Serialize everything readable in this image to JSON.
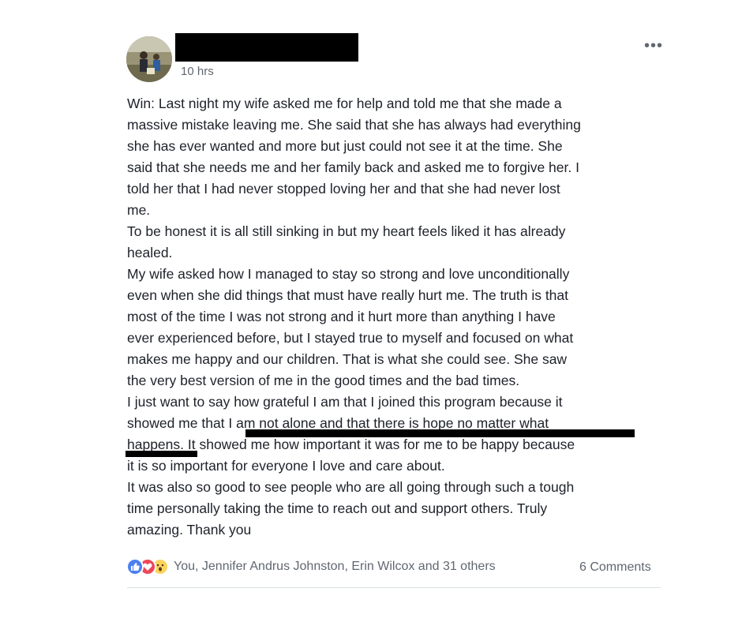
{
  "post": {
    "timestamp": "10 hrs",
    "more_label": "•••",
    "text": "Win: Last night my wife asked me for help and told me that she made a\nmassive mistake leaving me. She said that she has always had everything\nshe has ever wanted and more but just could not see it at the time. She\nsaid that she needs me and her family back and asked me to forgive her. I\ntold her that I had never stopped loving her and that she had never lost\nme.\nTo be honest it is all still sinking in but my heart feels liked it has already\nhealed.\nMy wife asked how I managed to stay so strong and love unconditionally\neven when she did things that must have really hurt me. The truth is that\nmost of the time I was not strong and it hurt more than anything I have\never experienced before, but I stayed true to myself and focused on what\nmakes me happy and our children. That is what she could see. She saw\nthe very best version of me in the good times and the bad times.\nI just want to say how grateful I am that I joined this program because it\nshowed me that I am not alone and that there is hope no matter what\nhappens. It showed me how important it was for me to be happy because\nit is so important for everyone I love and care about.\nIt was also so good to see people who are all going through such a tough\ntime personally taking the time to reach out and support others. Truly\namazing. Thank you"
  },
  "reactions": {
    "icons": [
      "like-icon",
      "love-icon",
      "wow-icon"
    ],
    "summary": "You, Jennifer Andrus Johnston, Erin Wilcox and 31 others",
    "comments": "6 Comments"
  },
  "colors": {
    "text": "#1d2129",
    "meta": "#606770",
    "like": "#4a80f0",
    "love": "#ee4759",
    "wow": "#fcd55a",
    "divider": "#dadde1"
  }
}
